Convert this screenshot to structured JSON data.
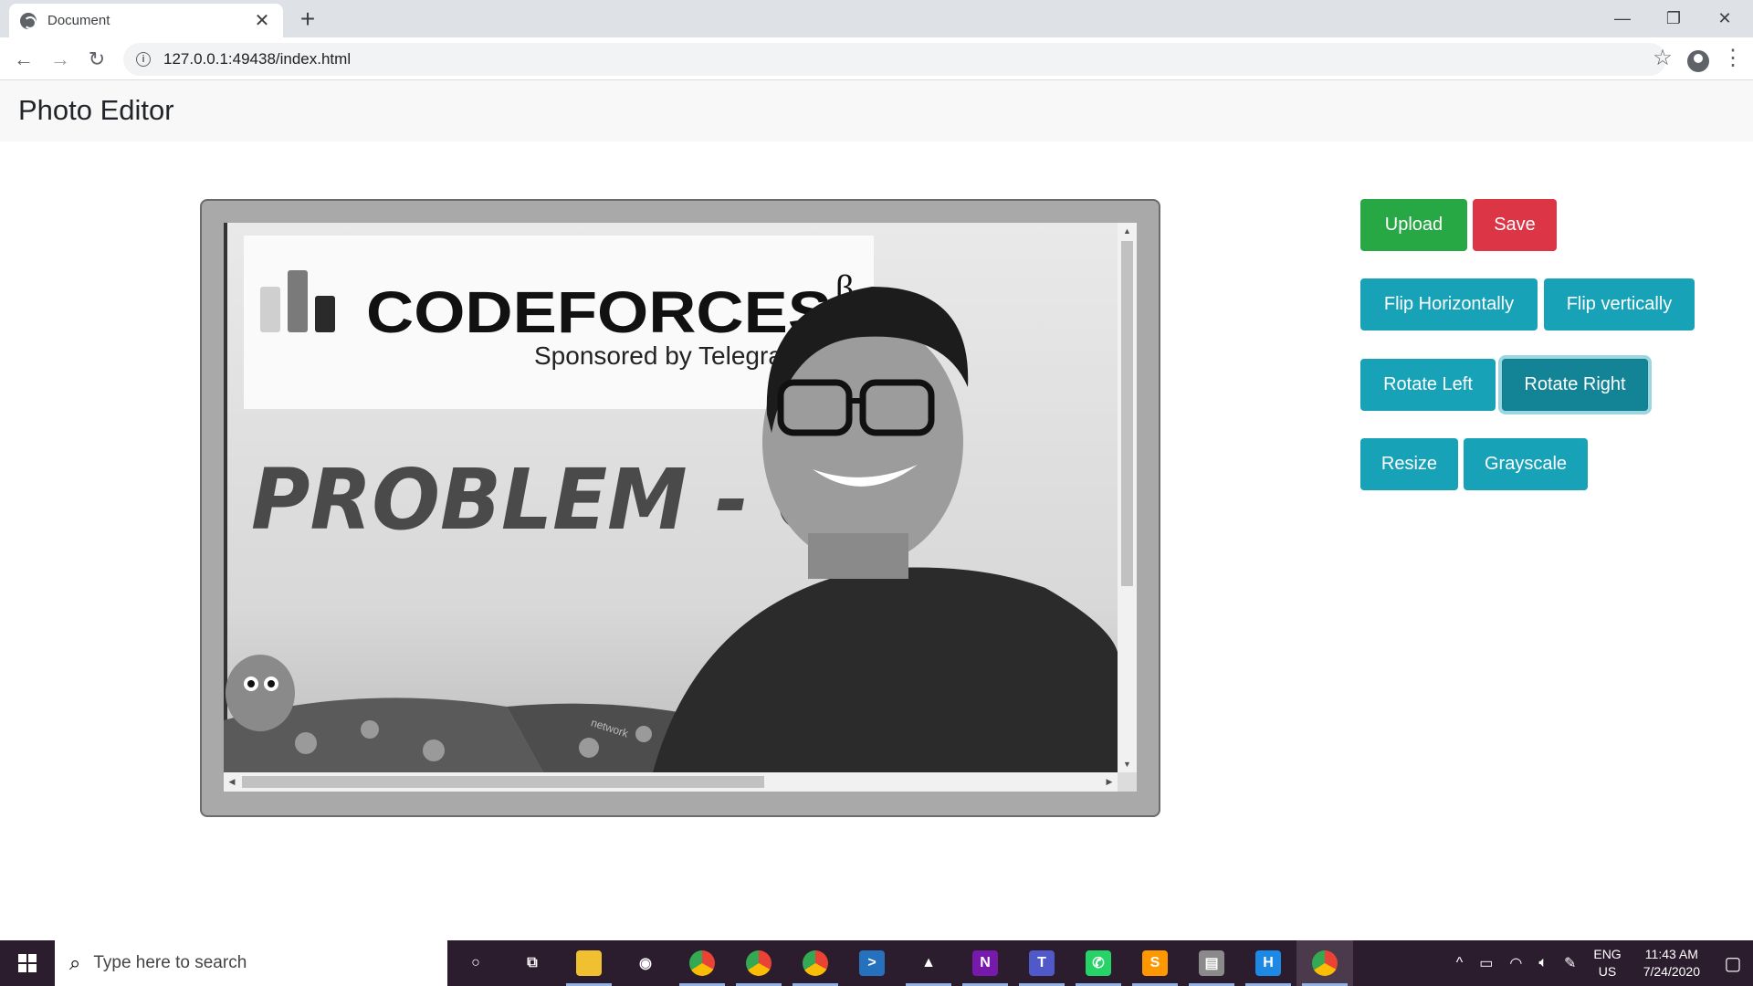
{
  "browser": {
    "tab_title": "Document",
    "tab_close": "✕",
    "new_tab": "+",
    "url": "127.0.0.1:49438/index.html",
    "window_controls": {
      "minimize": "—",
      "restore": "❐",
      "close": "✕"
    }
  },
  "page": {
    "brand": "Photo Editor"
  },
  "canvas": {
    "logo_text": "CODEFORCES",
    "logo_beta": "β",
    "sponsor_text": "Sponsored by Telegram",
    "headline": "PROBLEM - C",
    "shirt_text": "network"
  },
  "buttons": {
    "upload": "Upload",
    "save": "Save",
    "flip_h": "Flip Horizontally",
    "flip_v": "Flip vertically",
    "rotate_left": "Rotate Left",
    "rotate_right": "Rotate Right",
    "resize": "Resize",
    "grayscale": "Grayscale"
  },
  "taskbar": {
    "search_placeholder": "Type here to search",
    "apps": [
      {
        "name": "cortana-icon",
        "glyph": "○",
        "color": "#2c1d2e"
      },
      {
        "name": "task-view-icon",
        "glyph": "⧉",
        "color": "#2c1d2e"
      },
      {
        "name": "file-explorer-icon",
        "glyph": "",
        "color": "#f0c030"
      },
      {
        "name": "obs-icon",
        "glyph": "◉",
        "color": "#2c1d2e"
      },
      {
        "name": "chrome-icon",
        "glyph": "",
        "color": "#34a853"
      },
      {
        "name": "chrome-canary-icon",
        "glyph": "",
        "color": "#34a853"
      },
      {
        "name": "chrome-profile-icon",
        "glyph": "",
        "color": "#34a853"
      },
      {
        "name": "powershell-icon",
        "glyph": ">",
        "color": "#2671be"
      },
      {
        "name": "photos-icon",
        "glyph": "▲",
        "color": "#2c1d2e"
      },
      {
        "name": "onenote-icon",
        "glyph": "N",
        "color": "#7719aa"
      },
      {
        "name": "teams-icon",
        "glyph": "T",
        "color": "#5059c9"
      },
      {
        "name": "whatsapp-icon",
        "glyph": "✆",
        "color": "#25d366"
      },
      {
        "name": "sublime-icon",
        "glyph": "S",
        "color": "#ff9800"
      },
      {
        "name": "printer-icon",
        "glyph": "▤",
        "color": "#8a8a8a"
      },
      {
        "name": "app-icon",
        "glyph": "H",
        "color": "#1e88e5"
      },
      {
        "name": "chrome-active-icon",
        "glyph": "",
        "color": "#34a853"
      }
    ],
    "lang_top": "ENG",
    "lang_bottom": "US",
    "time": "11:43 AM",
    "date": "7/24/2020"
  }
}
